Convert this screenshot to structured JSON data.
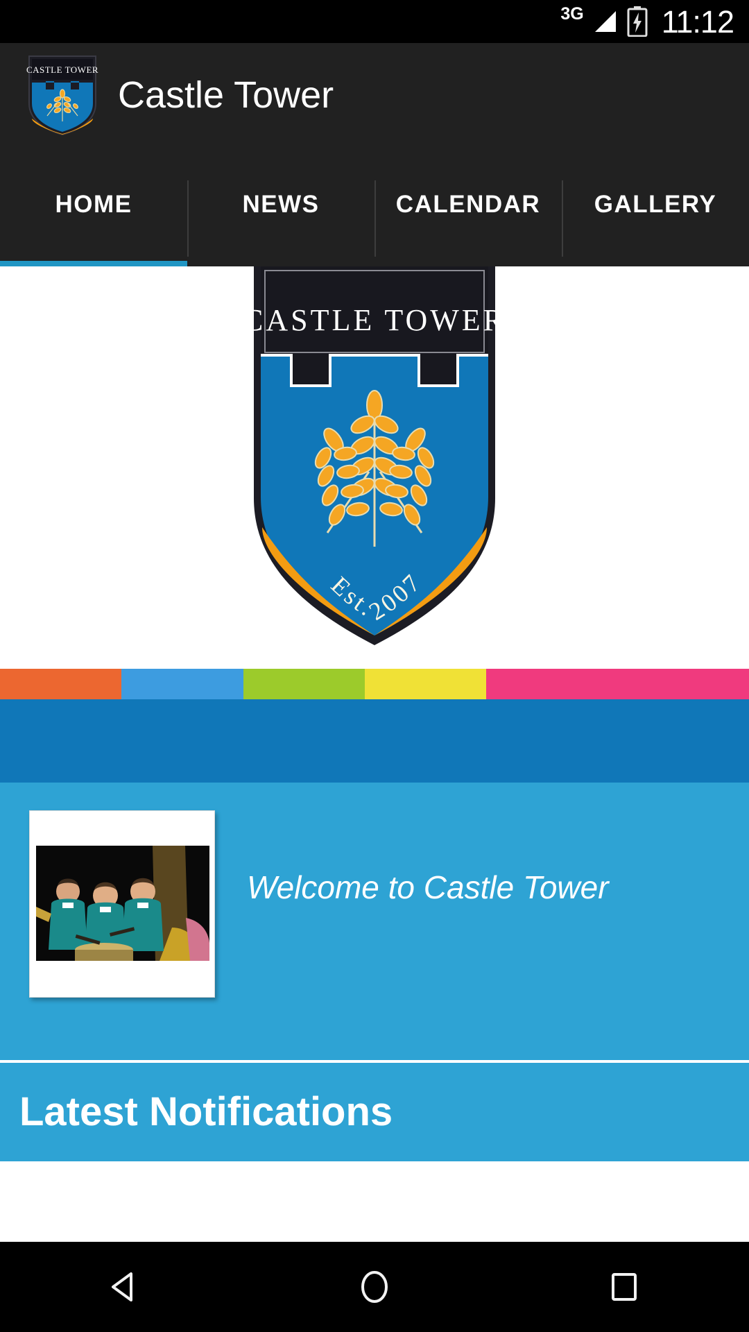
{
  "status_bar": {
    "network_label": "3G",
    "time": "11:12",
    "icons": [
      "signal-icon",
      "battery-charging-icon"
    ]
  },
  "action_bar": {
    "title": "Castle Tower",
    "logo_alt": "castle-tower-crest-icon"
  },
  "tabs": [
    {
      "label": "HOME",
      "active": true
    },
    {
      "label": "NEWS",
      "active": false
    },
    {
      "label": "CALENDAR",
      "active": false
    },
    {
      "label": "GALLERY",
      "active": false
    }
  ],
  "hero": {
    "crest_title": "CASTLE TOWER",
    "crest_established": "Est. 2007"
  },
  "stripes": [
    {
      "name": "stripe-orange",
      "color": "#ec6730",
      "width_pct": 16.2
    },
    {
      "name": "stripe-blue",
      "color": "#3d9ce0",
      "width_pct": 16.3
    },
    {
      "name": "stripe-green",
      "color": "#9ccb2b",
      "width_pct": 16.2
    },
    {
      "name": "stripe-yellow",
      "color": "#f0e136",
      "width_pct": 16.2
    },
    {
      "name": "stripe-pink",
      "color": "#f03a7e",
      "width_pct": 35.1
    }
  ],
  "mid_band": {
    "color": "#1077b8"
  },
  "welcome": {
    "heading": "Welcome to Castle Tower",
    "background": "#2ea3d4",
    "photo_alt": "children-playing-drums-photo"
  },
  "notifications": {
    "title": "Latest Notifications"
  },
  "nav_bar": {
    "back_label": "back-icon",
    "home_label": "home-icon",
    "recents_label": "recents-icon"
  },
  "colors": {
    "accent": "#2196c4",
    "action_bar": "#212121",
    "crest_blue": "#1077b8",
    "crest_orange": "#f39c12",
    "crest_dark": "#1c1c24"
  }
}
